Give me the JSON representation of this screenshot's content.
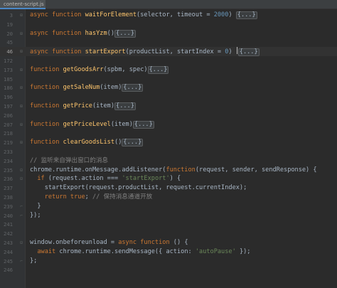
{
  "tab": {
    "label": "content-script.js"
  },
  "colors": {
    "background": "#2b2b2b",
    "gutter": "#313335",
    "keyword": "#cc7832",
    "function_name": "#ffc66d",
    "string": "#6a8759",
    "comment": "#808080",
    "number": "#6897bb",
    "plain": "#a9b7c6",
    "line_number": "#606366"
  },
  "lines": [
    {
      "num": "3",
      "fold": "+",
      "segments": [
        {
          "t": "async function ",
          "c": "kw"
        },
        {
          "t": "waitForElement",
          "c": "fn"
        },
        {
          "t": "(selector, timeout = ",
          "c": "par"
        },
        {
          "t": "2000",
          "c": "num"
        },
        {
          "t": ") ",
          "c": "par"
        },
        {
          "t": "{...}",
          "c": "fd"
        }
      ]
    },
    {
      "num": "19",
      "segments": []
    },
    {
      "num": "20",
      "fold": "+",
      "segments": [
        {
          "t": "async function ",
          "c": "kw"
        },
        {
          "t": "hasYzm",
          "c": "fn"
        },
        {
          "t": "()",
          "c": "par"
        },
        {
          "t": "{...}",
          "c": "fd"
        }
      ]
    },
    {
      "num": "45",
      "segments": []
    },
    {
      "num": "46",
      "fold": "+",
      "current": true,
      "segments": [
        {
          "t": "async function ",
          "c": "kw"
        },
        {
          "t": "startExport",
          "c": "fn"
        },
        {
          "t": "(productList, startIndex = ",
          "c": "par"
        },
        {
          "t": "0",
          "c": "num"
        },
        {
          "t": ") ",
          "c": "par"
        },
        {
          "t": "",
          "c": "caret"
        },
        {
          "t": "{...}",
          "c": "fd"
        }
      ]
    },
    {
      "num": "172",
      "segments": []
    },
    {
      "num": "173",
      "fold": "+",
      "segments": [
        {
          "t": "function ",
          "c": "kw"
        },
        {
          "t": "getGoodsArr",
          "c": "fn"
        },
        {
          "t": "(spbm, spec)",
          "c": "par"
        },
        {
          "t": "{...}",
          "c": "fd"
        }
      ]
    },
    {
      "num": "185",
      "segments": []
    },
    {
      "num": "186",
      "fold": "+",
      "segments": [
        {
          "t": "function ",
          "c": "kw"
        },
        {
          "t": "getSaleNum",
          "c": "fn"
        },
        {
          "t": "(item)",
          "c": "par"
        },
        {
          "t": "{...}",
          "c": "fd"
        }
      ]
    },
    {
      "num": "196",
      "segments": []
    },
    {
      "num": "197",
      "fold": "+",
      "segments": [
        {
          "t": "function ",
          "c": "kw"
        },
        {
          "t": "getPrice",
          "c": "fn"
        },
        {
          "t": "(item)",
          "c": "par"
        },
        {
          "t": "{...}",
          "c": "fd"
        }
      ]
    },
    {
      "num": "206",
      "segments": []
    },
    {
      "num": "207",
      "fold": "+",
      "segments": [
        {
          "t": "function ",
          "c": "kw"
        },
        {
          "t": "getPriceLevel",
          "c": "fn"
        },
        {
          "t": "(item)",
          "c": "par"
        },
        {
          "t": "{...}",
          "c": "fd"
        }
      ]
    },
    {
      "num": "218",
      "segments": []
    },
    {
      "num": "219",
      "fold": "+",
      "segments": [
        {
          "t": "function ",
          "c": "kw"
        },
        {
          "t": "clearGoodsList",
          "c": "fn"
        },
        {
          "t": "()",
          "c": "par"
        },
        {
          "t": "{...}",
          "c": "fd"
        }
      ]
    },
    {
      "num": "233",
      "segments": []
    },
    {
      "num": "234",
      "segments": [
        {
          "t": "// 监听来自弹出窗口的消息",
          "c": "cm"
        }
      ]
    },
    {
      "num": "235",
      "fold": "−",
      "segments": [
        {
          "t": "chrome.runtime.onMessage.addListener(",
          "c": "par"
        },
        {
          "t": "function",
          "c": "kw"
        },
        {
          "t": "(request, sender, sendResponse) {",
          "c": "par"
        }
      ]
    },
    {
      "num": "236",
      "fold": "−",
      "segments": [
        {
          "t": "  ",
          "c": "par"
        },
        {
          "t": "if",
          "c": "kw"
        },
        {
          "t": " (request.action === ",
          "c": "par"
        },
        {
          "t": "'startExport'",
          "c": "str"
        },
        {
          "t": ") {",
          "c": "par"
        }
      ]
    },
    {
      "num": "237",
      "segments": [
        {
          "t": "    startExport(request.productList, request.currentIndex);",
          "c": "par"
        }
      ]
    },
    {
      "num": "238",
      "segments": [
        {
          "t": "    ",
          "c": "par"
        },
        {
          "t": "return true",
          "c": "kw"
        },
        {
          "t": "; ",
          "c": "par"
        },
        {
          "t": "// 保持消息通道开放",
          "c": "cm"
        }
      ]
    },
    {
      "num": "239",
      "fold": "⌐",
      "segments": [
        {
          "t": "  }",
          "c": "par"
        }
      ]
    },
    {
      "num": "240",
      "fold": "⌐",
      "segments": [
        {
          "t": "});",
          "c": "par"
        }
      ]
    },
    {
      "num": "241",
      "segments": []
    },
    {
      "num": "242",
      "segments": []
    },
    {
      "num": "243",
      "fold": "−",
      "segments": [
        {
          "t": "window.onbeforeunload = ",
          "c": "par"
        },
        {
          "t": "async function",
          "c": "kw"
        },
        {
          "t": " () {",
          "c": "par"
        }
      ]
    },
    {
      "num": "244",
      "segments": [
        {
          "t": "  ",
          "c": "par"
        },
        {
          "t": "await",
          "c": "kw"
        },
        {
          "t": " chrome.runtime.sendMessage({ action: ",
          "c": "par"
        },
        {
          "t": "'autoPause'",
          "c": "str"
        },
        {
          "t": " });",
          "c": "par"
        }
      ]
    },
    {
      "num": "245",
      "fold": "⌐",
      "segments": [
        {
          "t": "};",
          "c": "par"
        }
      ]
    },
    {
      "num": "246",
      "segments": []
    }
  ]
}
